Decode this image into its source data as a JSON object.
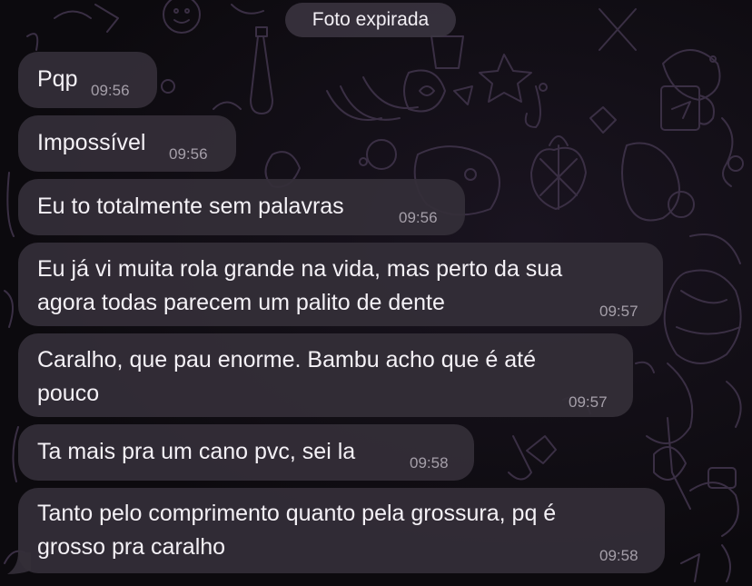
{
  "system_notice": "Foto expirada",
  "messages": [
    {
      "lines": [
        "Pqp"
      ],
      "time": "09:56"
    },
    {
      "lines": [
        "Impossível"
      ],
      "time": "09:56"
    },
    {
      "lines": [
        "Eu to totalmente sem palavras"
      ],
      "time": "09:56"
    },
    {
      "lines": [
        "Eu já vi muita rola grande na vida, mas perto da sua",
        "agora todas parecem um palito de dente"
      ],
      "time": "09:57"
    },
    {
      "lines": [
        "Caralho, que pau enorme. Bambu acho que é até",
        "pouco"
      ],
      "time": "09:57"
    },
    {
      "lines": [
        "Ta mais pra um cano pvc, sei la"
      ],
      "time": "09:58"
    },
    {
      "lines": [
        "Tanto pelo comprimento quanto pela grossura, pq é",
        "grosso pra caralho"
      ],
      "time": "09:58"
    }
  ],
  "colors": {
    "background": "#0d0a10",
    "bubble": "#342e38",
    "text": "#f4f1f6",
    "timestamp": "#a59fa9",
    "doodle": "#3a2f44"
  }
}
